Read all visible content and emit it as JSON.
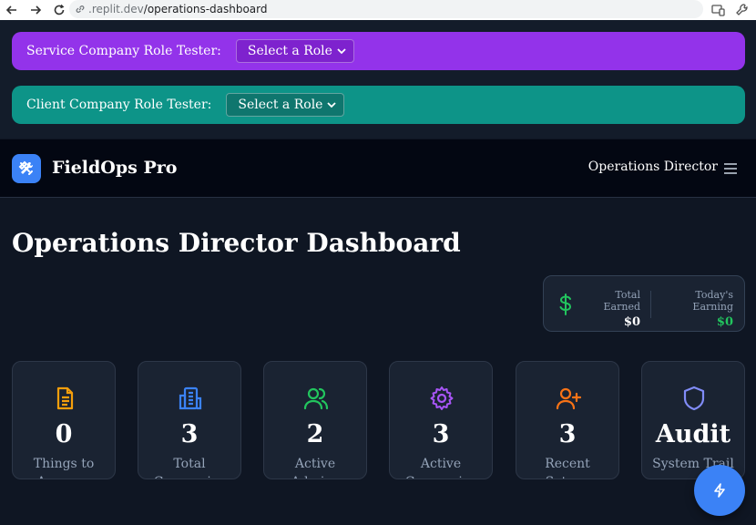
{
  "browser": {
    "url_domain": ".replit.dev",
    "url_path": "/operations-dashboard"
  },
  "testers": {
    "service": {
      "label": "Service Company Role Tester:",
      "selected": "Select a Role"
    },
    "client": {
      "label": "Client Company Role Tester:",
      "selected": "Select a Role"
    }
  },
  "header": {
    "brand": "FieldOps Pro",
    "role": "Operations Director"
  },
  "main": {
    "title": "Operations Director Dashboard",
    "earnings": {
      "total_label": "Total Earned",
      "total_value": "$0",
      "today_label": "Today's Earning",
      "today_value": "$0",
      "today_color": "#22c55e"
    },
    "stats": [
      {
        "value": "0",
        "label": "Things to Approve",
        "icon": "document-icon",
        "color": "#f59e0b"
      },
      {
        "value": "3",
        "label": "Total Companies",
        "icon": "building-icon",
        "color": "#3b82f6"
      },
      {
        "value": "2",
        "label": "Active Admins",
        "icon": "users-icon",
        "color": "#22c55e"
      },
      {
        "value": "3",
        "label": "Active Companies",
        "icon": "gear-icon",
        "color": "#a855f7"
      },
      {
        "value": "3",
        "label": "Recent Setups",
        "icon": "user-plus-icon",
        "color": "#f97316"
      },
      {
        "value": "Audit",
        "label": "System Trail",
        "icon": "shield-icon",
        "color": "#818cf8"
      }
    ]
  },
  "colors": {
    "service_bar": "#9333ea",
    "client_bar": "#0d9488",
    "accent": "#3b82f6"
  }
}
